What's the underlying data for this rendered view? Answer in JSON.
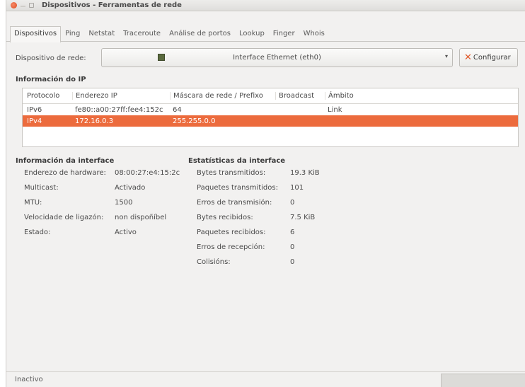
{
  "window": {
    "title": "Dispositivos - Ferramentas de rede"
  },
  "tabs": [
    "Dispositivos",
    "Ping",
    "Netstat",
    "Traceroute",
    "Análise de portos",
    "Lookup",
    "Finger",
    "Whois"
  ],
  "device": {
    "label": "Dispositivo de rede:",
    "selected": "Interface Ethernet (eth0)",
    "configure_label": "Configurar"
  },
  "ip_info": {
    "title": "Información do IP",
    "columns": [
      "Protocolo",
      "Enderezo IP",
      "Máscara de rede / Prefixo",
      "Broadcast",
      "Ámbito"
    ],
    "rows": [
      [
        "IPv6",
        "fe80::a00:27ff:fee4:152c",
        "64",
        "",
        "Link"
      ],
      [
        "IPv4",
        "172.16.0.3",
        "255.255.0.0",
        "",
        ""
      ]
    ]
  },
  "interface_info": {
    "title": "Información da interface",
    "items": [
      {
        "key": "Enderezo de hardware:",
        "value": "08:00:27:e4:15:2c"
      },
      {
        "key": "Multicast:",
        "value": "Activado"
      },
      {
        "key": "MTU:",
        "value": "1500"
      },
      {
        "key": "Velocidade de ligazón:",
        "value": "non dispoñíbel"
      },
      {
        "key": "Estado:",
        "value": "Activo"
      }
    ]
  },
  "interface_stats": {
    "title": "Estatísticas da interface",
    "items": [
      {
        "key": "Bytes transmitidos:",
        "value": "19.3 KiB"
      },
      {
        "key": "Paquetes transmitidos:",
        "value": "101"
      },
      {
        "key": "Erros de transmisión:",
        "value": "0"
      },
      {
        "key": "Bytes recibidos:",
        "value": "7.5 KiB"
      },
      {
        "key": "Paquetes recibidos:",
        "value": "6"
      },
      {
        "key": "Erros de recepción:",
        "value": "0"
      },
      {
        "key": "Colisións:",
        "value": "0"
      }
    ]
  },
  "status": {
    "text": "Inactivo"
  }
}
